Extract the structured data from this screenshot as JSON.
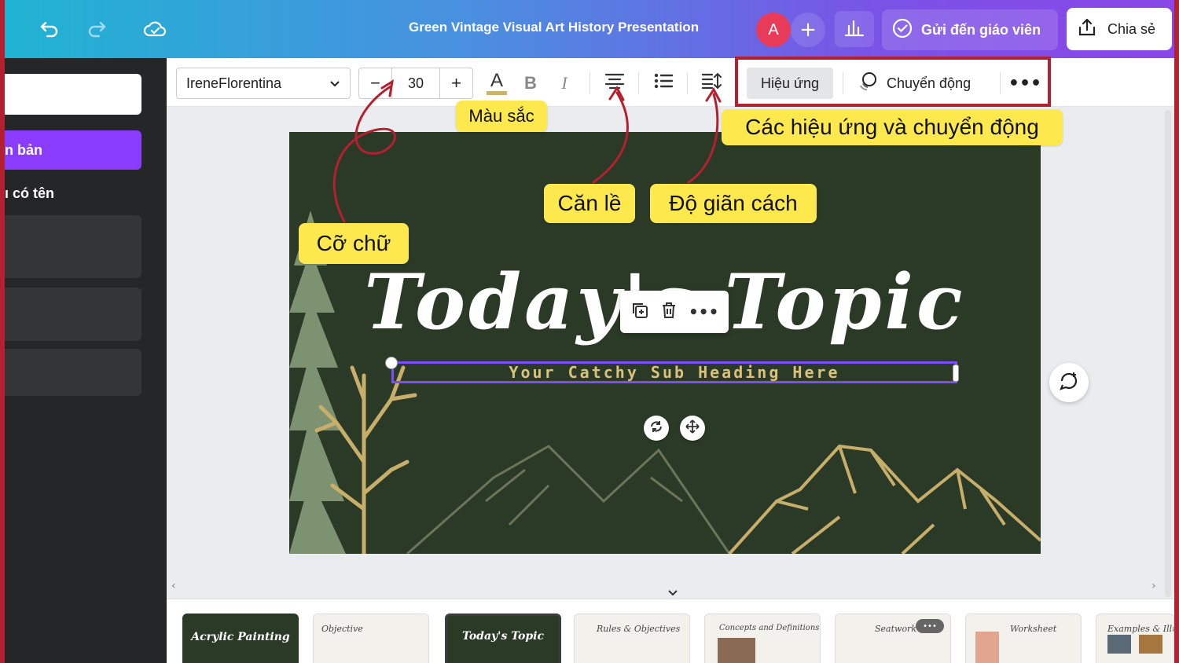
{
  "topbar": {
    "doc_title": "Green Vintage Visual Art History Presentation",
    "avatar_initial": "A",
    "add_symbol": "+",
    "send_teacher_label": "Gửi đến giáo viên",
    "share_label": "Chia sẻ",
    "icons": [
      "undo-icon",
      "redo-icon",
      "cloud-saved-icon",
      "insights-icon",
      "check-circle-icon",
      "share-upload-icon"
    ]
  },
  "leftpanel": {
    "button_label": "n bản",
    "section_label": "ı có tên"
  },
  "toolbar": {
    "font_name": "IreneFlorentina",
    "size_decrease": "−",
    "font_size": "30",
    "size_increase": "+",
    "color_glyph": "A",
    "bold_glyph": "B",
    "italic_glyph": "I",
    "effects_label": "Hiệu ứng",
    "animate_label": "Chuyển động",
    "more_glyph": "•••",
    "text_color_underline": "#c9b46a"
  },
  "slide": {
    "title": "Today's Topic",
    "subheading": "Your Catchy Sub Heading Here",
    "background": "#2b3a27"
  },
  "annotations": {
    "color": "Màu sắc",
    "effects_motion": "Các hiệu ứng và chuyển động",
    "align": "Căn lề",
    "spacing": "Độ giãn cách",
    "font_size": "Cỡ chữ"
  },
  "filmstrip": {
    "thumbs": [
      {
        "label": "Acrylic Painting",
        "bg": "#2b3a27",
        "color": "#fff"
      },
      {
        "label": "Objective",
        "bg": "#f3f1ec",
        "color": "#555"
      },
      {
        "label": "Today's Topic",
        "bg": "#2b3a27",
        "color": "#fff"
      },
      {
        "label": "Rules & Objectives",
        "bg": "#f3f1ec",
        "color": "#555"
      },
      {
        "label": "Concepts and Definitions",
        "bg": "#f3f1ec",
        "color": "#555"
      },
      {
        "label": "Seatwork",
        "bg": "#f3f1ec",
        "color": "#555"
      },
      {
        "label": "Worksheet",
        "bg": "#f3f1ec",
        "color": "#555"
      },
      {
        "label": "Examples & Illust",
        "bg": "#f3f1ec",
        "color": "#555"
      }
    ]
  },
  "colors": {
    "accent_purple": "#8b3dff",
    "highlight_red": "#b3202f",
    "note_yellow": "#fde94e"
  }
}
